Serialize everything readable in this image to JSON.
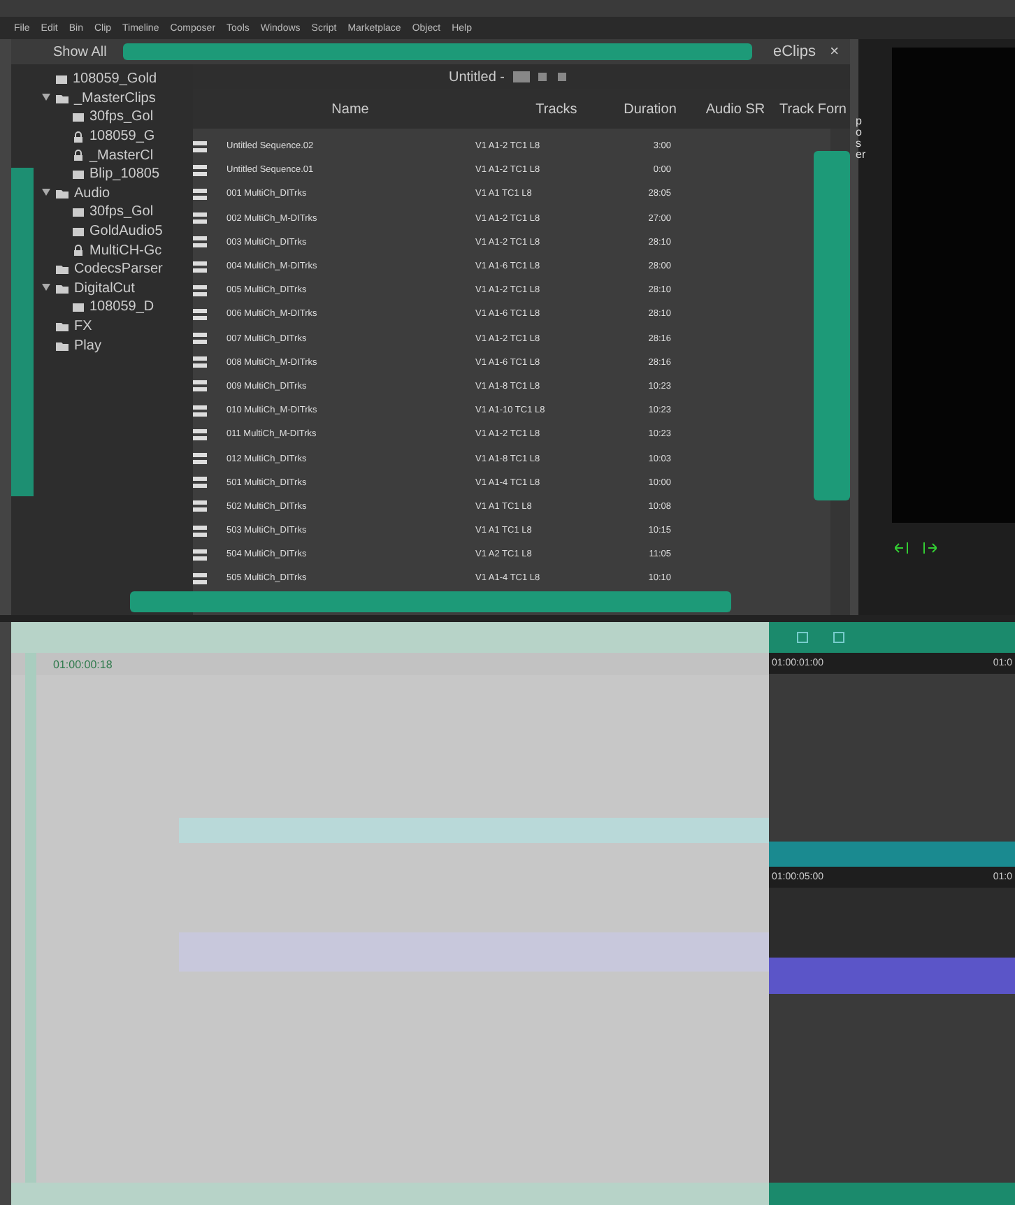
{
  "menu": [
    "File",
    "Edit",
    "Bin",
    "Clip",
    "Timeline",
    "Composer",
    "Tools",
    "Windows",
    "Script",
    "Marketplace",
    "Object",
    "Help"
  ],
  "bin": {
    "filter": "Show All",
    "tab": "eClips",
    "close": "×",
    "view": "Untitled -",
    "tree": [
      {
        "label": "108059_Gold",
        "kind": "bin"
      },
      {
        "label": "_MasterClips",
        "kind": "folder",
        "expanded": true,
        "children": [
          {
            "label": "30fps_Gol",
            "kind": "bin"
          },
          {
            "label": "108059_G",
            "kind": "locked"
          },
          {
            "label": "_MasterCl",
            "kind": "locked"
          },
          {
            "label": "Blip_10805",
            "kind": "bin"
          }
        ]
      },
      {
        "label": "Audio",
        "kind": "folder",
        "expanded": true,
        "children": [
          {
            "label": "30fps_Gol",
            "kind": "bin"
          },
          {
            "label": "GoldAudio5",
            "kind": "bin"
          },
          {
            "label": "MultiCH-Gc",
            "kind": "locked"
          }
        ]
      },
      {
        "label": "CodecsParser",
        "kind": "folder",
        "expanded": false
      },
      {
        "label": "DigitalCut",
        "kind": "folder",
        "expanded": true,
        "children": [
          {
            "label": "108059_D",
            "kind": "bin"
          }
        ]
      },
      {
        "label": "FX",
        "kind": "folder",
        "expanded": false
      },
      {
        "label": "Play",
        "kind": "folder",
        "expanded": false
      }
    ],
    "columns": [
      "Name",
      "Tracks",
      "Duration",
      "Audio SR",
      "Track Forn"
    ],
    "rows": [
      {
        "name": "Untitled Sequence.02",
        "tracks": "V1 A1-2 TC1 L8",
        "duration": "3:00"
      },
      {
        "name": "Untitled Sequence.01",
        "tracks": "V1 A1-2 TC1 L8",
        "duration": "0:00"
      },
      {
        "name": "001 MultiCh_DITrks",
        "tracks": "V1 A1 TC1 L8",
        "duration": "28:05"
      },
      {
        "name": "002 MultiCh_M-DITrks",
        "tracks": "V1 A1-2 TC1 L8",
        "duration": "27:00"
      },
      {
        "name": "003 MultiCh_DITrks",
        "tracks": "V1 A1-2 TC1 L8",
        "duration": "28:10"
      },
      {
        "name": "004 MultiCh_M-DITrks",
        "tracks": "V1 A1-6 TC1 L8",
        "duration": "28:00"
      },
      {
        "name": "005 MultiCh_DITrks",
        "tracks": "V1 A1-2 TC1 L8",
        "duration": "28:10"
      },
      {
        "name": "006 MultiCh_M-DITrks",
        "tracks": "V1 A1-6 TC1 L8",
        "duration": "28:10"
      },
      {
        "name": "007 MultiCh_DITrks",
        "tracks": "V1 A1-2 TC1 L8",
        "duration": "28:16"
      },
      {
        "name": "008 MultiCh_M-DITrks",
        "tracks": "V1 A1-6 TC1 L8",
        "duration": "28:16"
      },
      {
        "name": "009 MultiCh_DITrks",
        "tracks": "V1 A1-8 TC1 L8",
        "duration": "10:23"
      },
      {
        "name": "010 MultiCh_M-DITrks",
        "tracks": "V1 A1-10 TC1 L8",
        "duration": "10:23"
      },
      {
        "name": "011 MultiCh_M-DITrks",
        "tracks": "V1 A1-2 TC1 L8",
        "duration": "10:23"
      },
      {
        "name": "012 MultiCh_DITrks",
        "tracks": "V1 A1-8 TC1 L8",
        "duration": "10:03"
      },
      {
        "name": "501 MultiCh_DITrks",
        "tracks": "V1 A1-4 TC1 L8",
        "duration": "10:00"
      },
      {
        "name": "502 MultiCh_DITrks",
        "tracks": "V1 A1 TC1 L8",
        "duration": "10:08"
      },
      {
        "name": "503 MultiCh_DITrks",
        "tracks": "V1 A1 TC1 L8",
        "duration": "10:15"
      },
      {
        "name": "504 MultiCh_DITrks",
        "tracks": "V1 A2 TC1 L8",
        "duration": "11:05"
      },
      {
        "name": "505 MultiCh_DITrks",
        "tracks": "V1 A1-4 TC1 L8",
        "duration": "10:10"
      }
    ]
  },
  "composer": {
    "label": "poser"
  },
  "timeline": {
    "timecode": "01:00:00:18",
    "ruler_top": [
      "01:00:01:00",
      "01:0"
    ],
    "ruler_bottom": [
      "01:00:05:00",
      "01:0"
    ]
  }
}
